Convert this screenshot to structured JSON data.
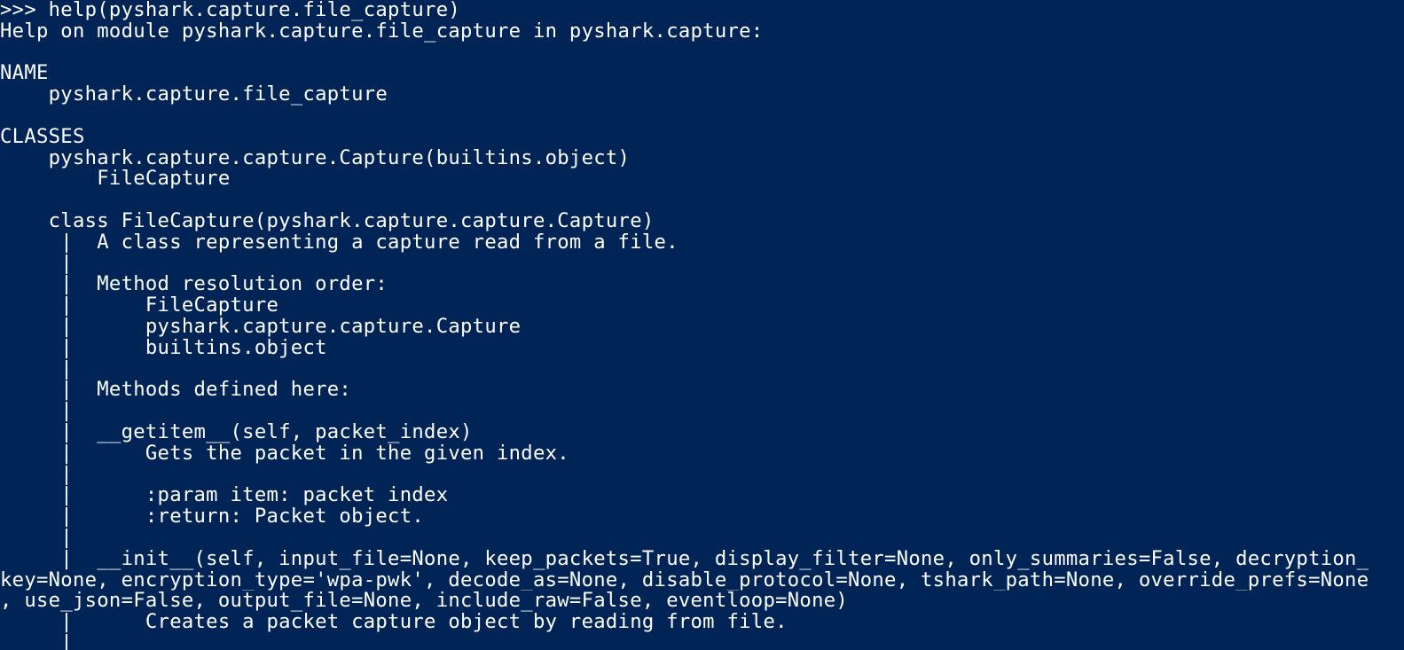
{
  "terminal": {
    "background": "#012456",
    "foreground": "#ffffff",
    "lines": [
      ">>> help(pyshark.capture.file_capture)",
      "Help on module pyshark.capture.file_capture in pyshark.capture:",
      "",
      "NAME",
      "    pyshark.capture.file_capture",
      "",
      "CLASSES",
      "    pyshark.capture.capture.Capture(builtins.object)",
      "        FileCapture",
      "",
      "    class FileCapture(pyshark.capture.capture.Capture)",
      "     |  A class representing a capture read from a file.",
      "     |",
      "     |  Method resolution order:",
      "     |      FileCapture",
      "     |      pyshark.capture.capture.Capture",
      "     |      builtins.object",
      "     |",
      "     |  Methods defined here:",
      "     |",
      "     |  __getitem__(self, packet_index)",
      "     |      Gets the packet in the given index.",
      "     |",
      "     |      :param item: packet index",
      "     |      :return: Packet object.",
      "     |",
      "     |  __init__(self, input_file=None, keep_packets=True, display_filter=None, only_summaries=False, decryption_",
      "key=None, encryption_type='wpa-pwk', decode_as=None, disable_protocol=None, tshark_path=None, override_prefs=None",
      ", use_json=False, output_file=None, include_raw=False, eventloop=None)",
      "     |      Creates a packet capture object by reading from file.",
      "     |"
    ]
  }
}
